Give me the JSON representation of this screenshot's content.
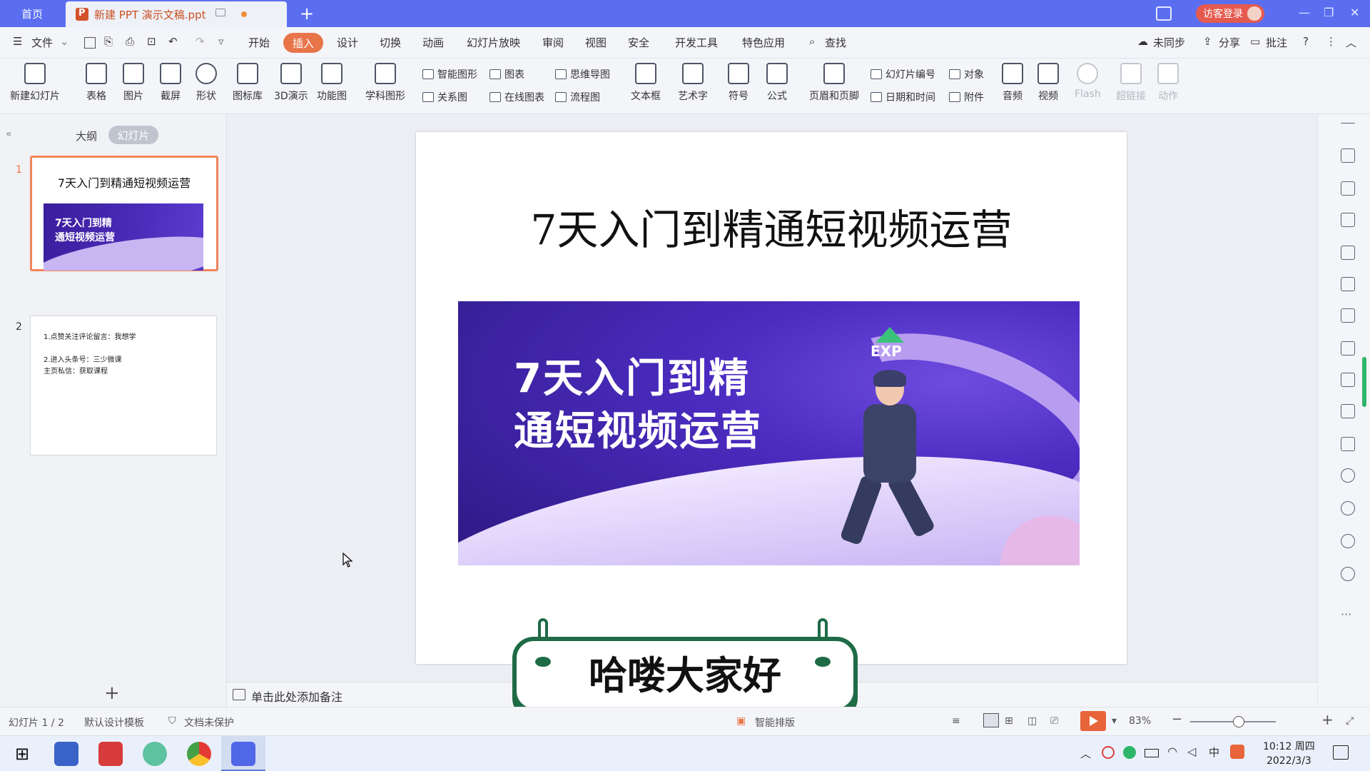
{
  "titlebar": {
    "home_tab": "首页",
    "doc_tab": "新建 PPT 演示文稿.ppt",
    "login_button": "访客登录"
  },
  "menubar": {
    "file": "文件",
    "items": [
      "开始",
      "插入",
      "设计",
      "切换",
      "动画",
      "幻灯片放映",
      "审阅",
      "视图",
      "安全",
      "开发工具",
      "特色应用"
    ],
    "active": "插入",
    "search": "查找",
    "sync": "未同步",
    "share": "分享",
    "comment": "批注"
  },
  "ribbon": {
    "new_slide": "新建幻灯片",
    "table": "表格",
    "picture": "图片",
    "screenshot": "截屏",
    "shape": "形状",
    "icon_lib": "图标库",
    "demo3d": "3D演示",
    "func_chart": "功能图",
    "subject_shape": "学科图形",
    "smart_shape": "智能图形",
    "chart": "图表",
    "mindmap": "思维导图",
    "relation": "关系图",
    "online_chart": "在线图表",
    "flowchart": "流程图",
    "textbox": "文本框",
    "wordart": "艺术字",
    "symbol": "符号",
    "formula": "公式",
    "header_footer": "页眉和页脚",
    "slide_number": "幻灯片编号",
    "object": "对象",
    "datetime": "日期和时间",
    "attachment": "附件",
    "audio": "音频",
    "video": "视频",
    "flash": "Flash",
    "hyperlink": "超链接",
    "action": "动作"
  },
  "leftpanel": {
    "outline": "大纲",
    "slides": "幻灯片",
    "slide1": {
      "num": "1",
      "title": "7天入门到精通短视频运营",
      "banner_line1": "7天入门到精",
      "banner_line2": "通短视频运营"
    },
    "slide2": {
      "num": "2",
      "line1": "1.点赞关注评论留言：我想学",
      "line2": "2.进入头条号：三少微课",
      "line3": "主页私信：获取课程"
    }
  },
  "slide": {
    "title": "7天入门到精通短视频运营",
    "banner_line1": "7天入门到精",
    "banner_line2": "通短视频运营",
    "exp": "EXP"
  },
  "subtitle_overlay": "哈喽大家好",
  "notes_placeholder": "单击此处添加备注",
  "statusbar": {
    "slide_pos": "幻灯片 1 / 2",
    "template": "默认设计模板",
    "protect": "文档未保护",
    "smart_layout": "智能排版",
    "zoom": "83%"
  },
  "taskbar": {
    "time": "10:12 周四",
    "date": "2022/3/3",
    "ime": "中"
  },
  "colors": {
    "titlebar": "#5b6ef0",
    "accent": "#e8754a",
    "subtitle_green": "#1e6b45"
  }
}
